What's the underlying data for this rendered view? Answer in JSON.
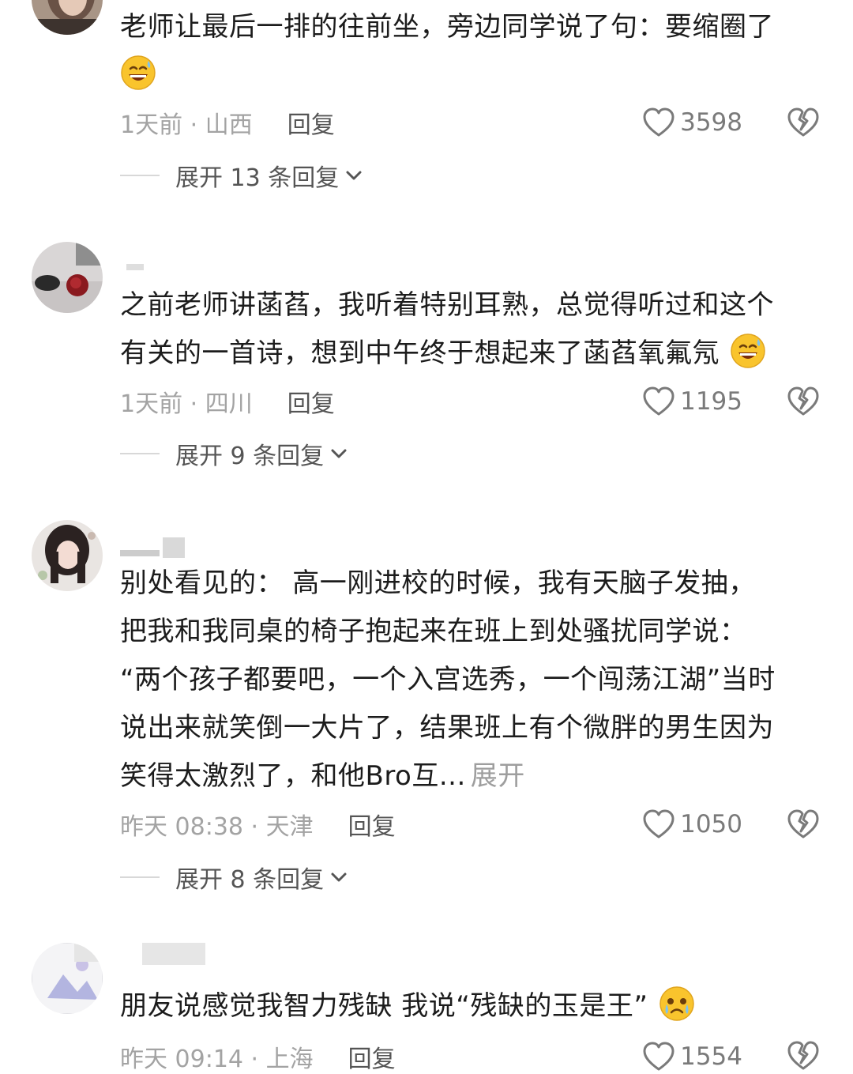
{
  "colors": {
    "text_primary": "#1c1c1c",
    "text_secondary": "#a3a3a3",
    "reply_text": "#555555",
    "emoji_yellow": "#f9c42d"
  },
  "comments": [
    {
      "username": "",
      "lines": [
        "老师让最后一排的往前坐，旁边同学说了句：要缩圈了",
        ""
      ],
      "emoji": "grinning-sweat-emoji",
      "time_location": "1天前 · 山西",
      "reply_label": "回复",
      "likes": "3598",
      "expand_replies": "展开 13 条回复"
    },
    {
      "username": "",
      "lines": [
        "之前老师讲菡萏，我听着特别耳熟，总觉得听过和这个",
        "有关的一首诗，想到中午终于想起来了菡萏氧氟氖"
      ],
      "emoji": "grinning-sweat-emoji",
      "time_location": "1天前 · 四川",
      "reply_label": "回复",
      "likes": "1195",
      "expand_replies": "展开 9 条回复"
    },
    {
      "username": "",
      "lines": [
        "别处看见的：  高一刚进校的时候，我有天脑子发抽，",
        "把我和我同桌的椅子抱起来在班上到处骚扰同学说：",
        "“两个孩子都要吧，一个入宫选秀，一个闯荡江湖”当时",
        "说出来就笑倒一大片了，结果班上有个微胖的男生因为",
        "笑得太激烈了，和他Bro互..."
      ],
      "expand_label": "展开",
      "time_location": "昨天 08:38 · 天津",
      "reply_label": "回复",
      "likes": "1050",
      "expand_replies": "展开 8 条回复"
    },
    {
      "username": "",
      "lines": [
        "朋友说感觉我智力残缺 我说“残缺的玉是王”"
      ],
      "emoji": "crying-face-emoji",
      "time_location": "昨天 09:14 · 上海",
      "reply_label": "回复",
      "likes": "1554"
    }
  ]
}
